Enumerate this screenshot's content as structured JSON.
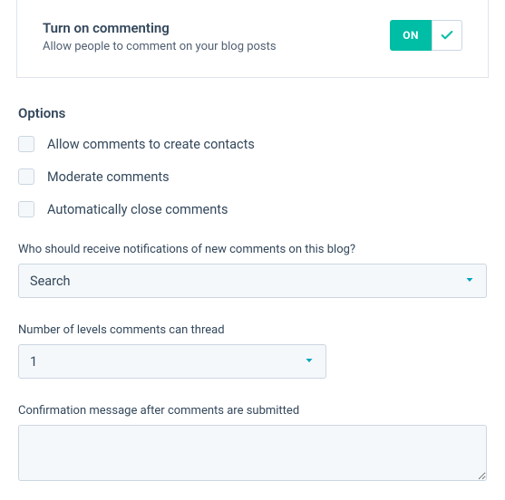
{
  "panel": {
    "title": "Turn on commenting",
    "subtitle": "Allow people to comment on your blog posts",
    "toggle_label": "ON"
  },
  "options": {
    "heading": "Options",
    "items": [
      {
        "label": "Allow comments to create contacts"
      },
      {
        "label": "Moderate comments"
      },
      {
        "label": "Automatically close comments"
      }
    ]
  },
  "notifications": {
    "label": "Who should receive notifications of new comments on this blog?",
    "placeholder": "Search"
  },
  "threading": {
    "label": "Number of levels comments can thread",
    "value": "1"
  },
  "confirmation": {
    "label": "Confirmation message after comments are submitted",
    "value": ""
  }
}
